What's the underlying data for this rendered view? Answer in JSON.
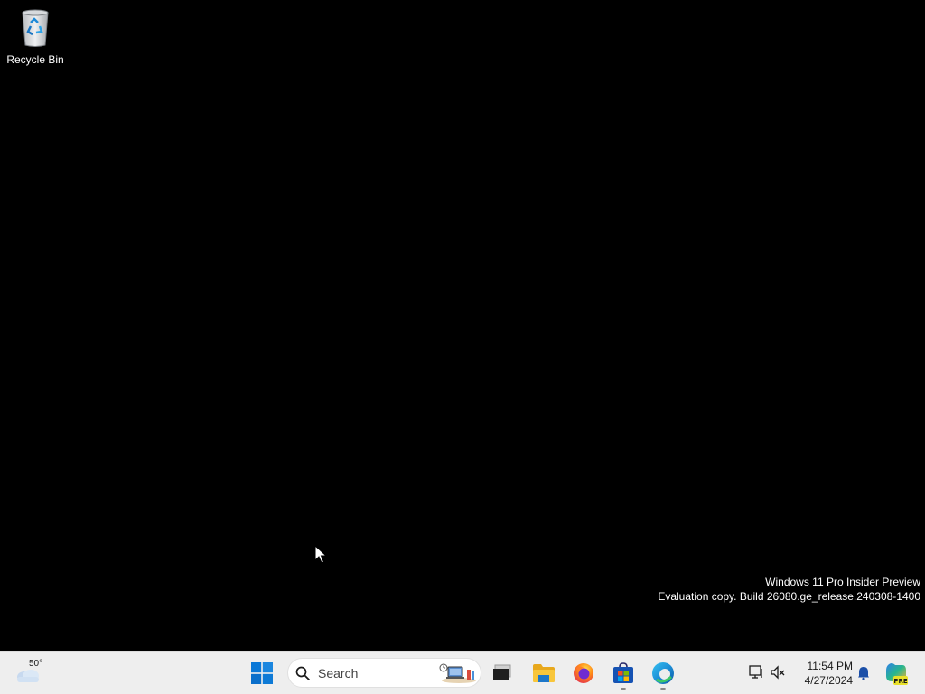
{
  "desktop": {
    "icons": [
      {
        "label": "Recycle Bin",
        "icon": "recycle-bin-icon"
      }
    ],
    "watermark": {
      "line1": "Windows 11 Pro Insider Preview",
      "line2": "Evaluation copy. Build 26080.ge_release.240308-1400"
    }
  },
  "taskbar": {
    "weather": {
      "temperature": "50°",
      "icon": "partly-cloudy-icon"
    },
    "start": {
      "icon": "windows-start-icon"
    },
    "search": {
      "placeholder": "Search",
      "icon": "search-icon"
    },
    "pinned_apps": [
      {
        "name": "task-view",
        "icon": "task-view-icon",
        "running": false
      },
      {
        "name": "file-explorer",
        "icon": "folder-icon",
        "running": false
      },
      {
        "name": "firefox",
        "icon": "firefox-icon",
        "running": false
      },
      {
        "name": "microsoft-store",
        "icon": "store-icon",
        "running": true
      },
      {
        "name": "edge",
        "icon": "edge-icon",
        "running": true
      }
    ],
    "tray": {
      "icons": [
        "network-icon",
        "volume-muted-icon"
      ],
      "time": "11:54 PM",
      "date": "4/27/2024",
      "notification_icon": "bell-icon",
      "copilot_icon": "copilot-pre-icon",
      "copilot_badge": "PRE"
    }
  },
  "colors": {
    "desktop_background": "#000000",
    "taskbar_background": "#eeeeee",
    "windows_blue": "#0078d4"
  }
}
